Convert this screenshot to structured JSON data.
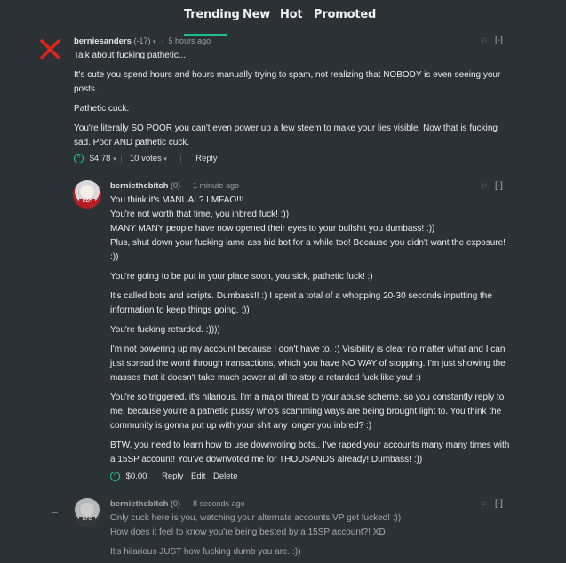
{
  "nav": {
    "tabs": [
      {
        "label": "Trending",
        "active": true
      },
      {
        "label": "New"
      },
      {
        "label": "Hot"
      },
      {
        "label": "Promoted"
      }
    ],
    "accent": "#1fbf8f"
  },
  "comments": [
    {
      "author": "berniesanders",
      "rep": "(-17)",
      "time": "5 hours ago",
      "collapse": "[-]",
      "status_icon": "red-x-icon",
      "paragraphs": [
        "Talk about fucking pathetic...",
        "It's cute you spend hours and hours manually trying to spam, not realizing that NOBODY is even seeing your posts.",
        "Pathetic cuck.",
        "You're literally SO POOR you can't even power up a few steem to make your lies visible. Now that is fucking sad. Poor AND pathetic cuck."
      ],
      "payout": "$4.78",
      "votes": "10 votes",
      "reply": "Reply"
    },
    {
      "author": "berniethebitch",
      "rep": "(0)",
      "time": "1 minute ago",
      "collapse": "[-]",
      "paragraphs": [
        "You think it's MANUAL? LMFAO!!!",
        "You're not worth that time, you inbred fuck! :))",
        "MANY MANY people have now opened their eyes to your bullshit you dumbass! :))",
        "Plus, shut down your fucking lame ass bid bot for a while too! Because you didn't want the exposure! :))",
        "You're going to be put in your place soon, you sick, pathetic fuck! :)",
        "It's called bots and scripts. Dumbass!! :) I spent a total of a whopping 20-30 seconds inputting the information to keep things going. :))",
        "You're fucking retarded. :))))",
        "I'm not powering up my account because I don't have to. :) Visibility is clear no matter what and I can just spread the word through transactions, which you have NO WAY of stopping. I'm just showing the masses that it doesn't take much power at all to stop a retarded fuck like you! :)",
        "You're so triggered, it's hilarious. I'm a major threat to your abuse scheme, so you constantly reply to me, because you're a pathetic pussy who's scamming ways are being brought light to. You think the community is gonna put up with your shit any longer you inbred? :)",
        "BTW, you need to learn how to use downvoting bots.. I've raped your accounts many many times with a 15SP account! You've downvoted me for THOUSANDS already! Dumbass! :))"
      ],
      "payout": "$0.00",
      "reply": "Reply",
      "edit": "Edit",
      "delete": "Delete"
    },
    {
      "author": "berniethebitch",
      "rep": "(0)",
      "time": "8 seconds ago",
      "collapse": "[-]",
      "paragraphs": [
        "Only cuck here is you, watching your alternate accounts VP get fucked! :))",
        "How does it feel to know you're being bested by a 15SP account?! XD",
        "It's hilarious JUST how fucking dumb you are. :))"
      ]
    }
  ]
}
